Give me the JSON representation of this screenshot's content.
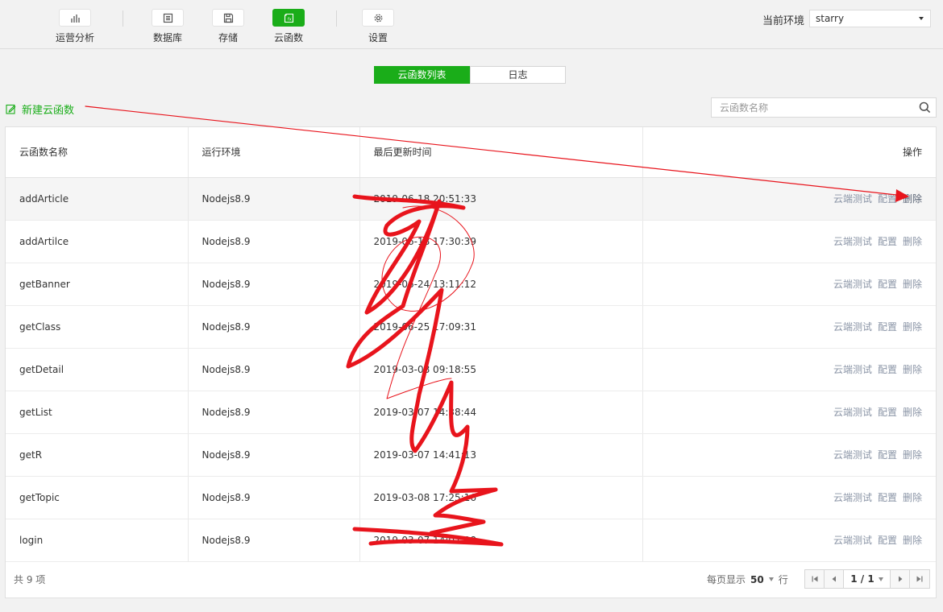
{
  "toolbar": {
    "items": [
      {
        "label": "运营分析",
        "icon": "bar-chart-icon",
        "active": false
      },
      {
        "label": "数据库",
        "icon": "database-icon",
        "active": false
      },
      {
        "label": "存储",
        "icon": "save-icon",
        "active": false
      },
      {
        "label": "云函数",
        "icon": "function-icon",
        "active": true
      },
      {
        "label": "设置",
        "icon": "gear-icon",
        "active": false
      }
    ],
    "env_label": "当前环境",
    "env_value": "starry"
  },
  "tabs": [
    {
      "label": "云函数列表",
      "active": true
    },
    {
      "label": "日志",
      "active": false
    }
  ],
  "actions": {
    "new_function_label": "新建云函数",
    "search_placeholder": "云函数名称"
  },
  "table": {
    "columns": [
      "云函数名称",
      "运行环境",
      "最后更新时间",
      "操作"
    ],
    "row_actions": [
      "云端测试",
      "配置",
      "删除"
    ],
    "rows": [
      {
        "name": "addArticle",
        "runtime": "Nodejs8.9",
        "updated": "2019-06-18 20:51:33"
      },
      {
        "name": "addArtilce",
        "runtime": "Nodejs8.9",
        "updated": "2019-06-18 17:30:39"
      },
      {
        "name": "getBanner",
        "runtime": "Nodejs8.9",
        "updated": "2019-06-24 13:11:12"
      },
      {
        "name": "getClass",
        "runtime": "Nodejs8.9",
        "updated": "2019-06-25 17:09:31"
      },
      {
        "name": "getDetail",
        "runtime": "Nodejs8.9",
        "updated": "2019-03-08 09:18:55"
      },
      {
        "name": "getList",
        "runtime": "Nodejs8.9",
        "updated": "2019-03-07 14:38:44"
      },
      {
        "name": "getR",
        "runtime": "Nodejs8.9",
        "updated": "2019-03-07 14:41:13"
      },
      {
        "name": "getTopic",
        "runtime": "Nodejs8.9",
        "updated": "2019-03-08 17:25:16"
      },
      {
        "name": "login",
        "runtime": "Nodejs8.9",
        "updated": "2019-03-07 14:07:08"
      }
    ]
  },
  "footer": {
    "total": "共 9 项",
    "per_page_label": "每页显示",
    "per_page_value": "50",
    "per_page_unit": "行",
    "page_info": "1 / 1"
  },
  "annotation_color": "#e8141c",
  "accent_color": "#1aad19"
}
